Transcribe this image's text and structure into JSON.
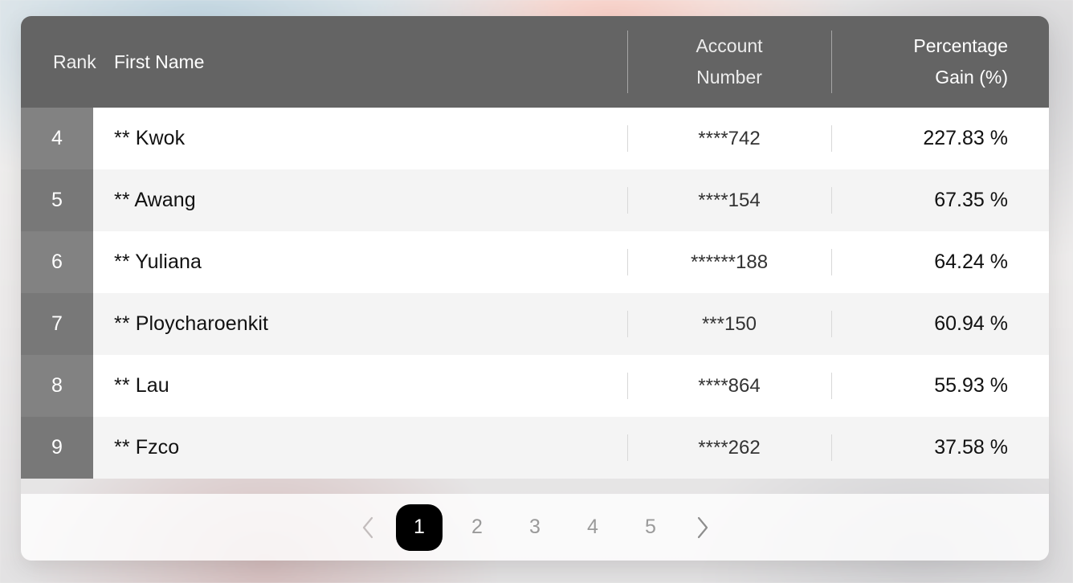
{
  "background": {
    "accent_blue": "#bed4e0",
    "accent_peach": "#f8cec5",
    "accent_gray": "#cdcdd0",
    "accent_mauve": "#d5bcbc"
  },
  "table": {
    "header_bg": "#646464",
    "rank_bg_odd": "#828282",
    "rank_bg_even": "#787878",
    "columns": [
      {
        "key": "rank",
        "label": "Rank"
      },
      {
        "key": "name",
        "label": "First Name"
      },
      {
        "key": "account",
        "label_line1": "Account",
        "label_line2": "Number"
      },
      {
        "key": "gain",
        "label_line1": "Percentage",
        "label_line2": "Gain (%)"
      }
    ],
    "rows": [
      {
        "rank": "4",
        "name": "** Kwok",
        "account": "****742",
        "gain": "227.83 %"
      },
      {
        "rank": "5",
        "name": "** Awang",
        "account": "****154",
        "gain": "67.35 %"
      },
      {
        "rank": "6",
        "name": "** Yuliana",
        "account": "******188",
        "gain": "64.24 %"
      },
      {
        "rank": "7",
        "name": "** Ploycharoenkit",
        "account": "***150",
        "gain": "60.94 %"
      },
      {
        "rank": "8",
        "name": "** Lau",
        "account": "****864",
        "gain": "55.93 %"
      },
      {
        "rank": "9",
        "name": "** Fzco",
        "account": "****262",
        "gain": "37.58 %"
      }
    ]
  },
  "pagination": {
    "prev_icon": "chevron-left-icon",
    "next_icon": "chevron-right-icon",
    "active_page": "1",
    "active_color": "#000000",
    "pages": [
      "1",
      "2",
      "3",
      "4",
      "5"
    ]
  }
}
